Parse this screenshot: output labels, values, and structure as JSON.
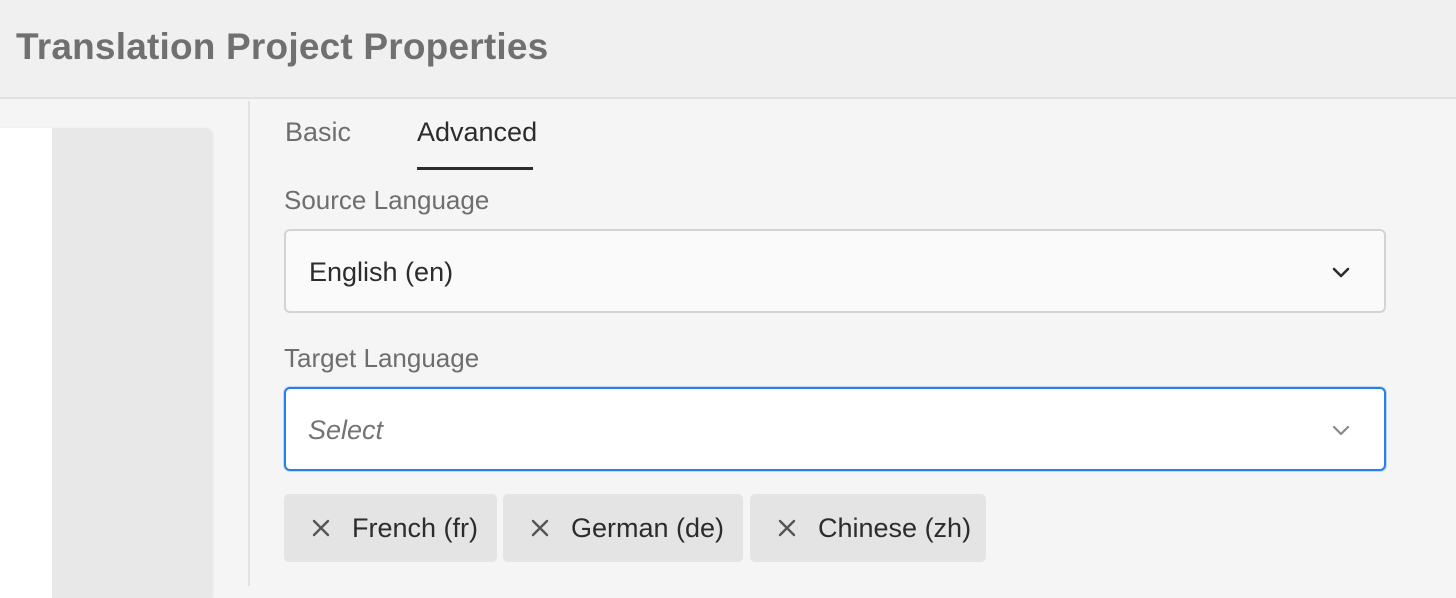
{
  "header": {
    "title": "Translation Project Properties"
  },
  "tabs": [
    {
      "label": "Basic",
      "active": false
    },
    {
      "label": "Advanced",
      "active": true
    }
  ],
  "source_language": {
    "label": "Source Language",
    "value": "English (en)",
    "icon": "chevron-down-icon"
  },
  "target_language": {
    "label": "Target Language",
    "placeholder": "Select",
    "icon": "chevron-down-icon",
    "selected": [
      {
        "label": "French (fr)",
        "icon": "close-icon"
      },
      {
        "label": "German (de)",
        "icon": "close-icon"
      },
      {
        "label": "Chinese (zh)",
        "icon": "close-icon"
      }
    ]
  },
  "colors": {
    "focus_border": "#2680eb",
    "active_tab_indicator": "#2c2c2c",
    "tag_background": "#e4e4e4"
  }
}
